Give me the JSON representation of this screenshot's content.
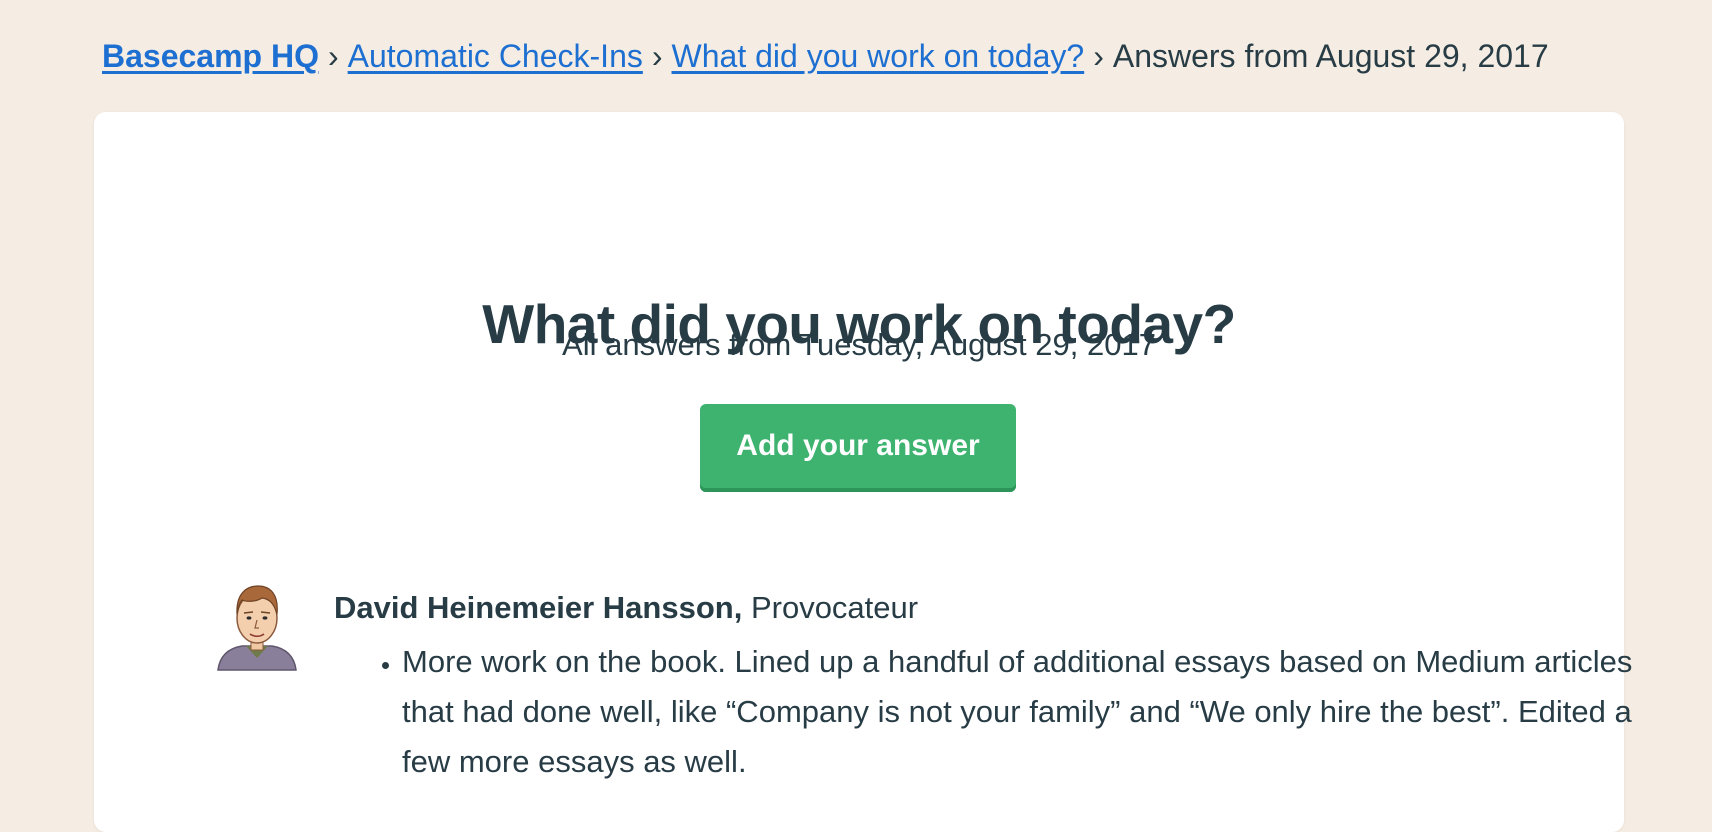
{
  "breadcrumb": {
    "items": [
      {
        "label": "Basecamp HQ"
      },
      {
        "label": "Automatic Check-Ins"
      },
      {
        "label": "What did you work on today?"
      }
    ],
    "current": "Answers from August 29, 2017",
    "separator": "›"
  },
  "page": {
    "title": "What did you work on today?",
    "subtitle": "All answers from Tuesday, August 29, 2017",
    "add_button_label": "Add your answer"
  },
  "answers": [
    {
      "author_name": "David Heinemeier Hansson,",
      "author_role": "Provocateur",
      "avatar_icon": "person-avatar-icon",
      "items": [
        "More work on the book. Lined up a handful of additional essays based on Medium articles that had done well, like “Company is not your family” and “We only hire the best”. Edited a few more essays as well."
      ]
    }
  ],
  "colors": {
    "background": "#f5ede3",
    "card": "#ffffff",
    "link": "#1d6fd1",
    "text": "#283c46",
    "button": "#3db36f"
  }
}
